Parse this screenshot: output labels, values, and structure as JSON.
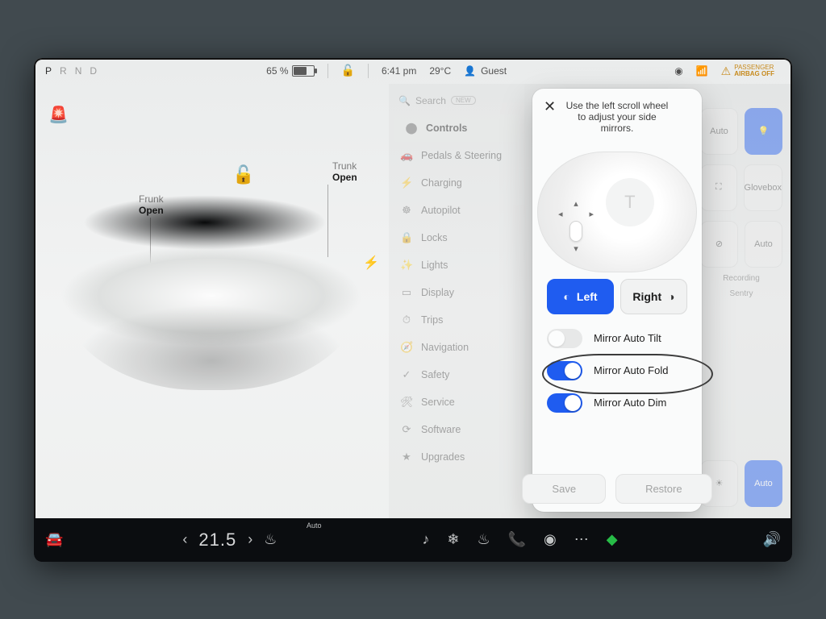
{
  "status": {
    "gear": {
      "p": "P",
      "r": "R",
      "n": "N",
      "d": "D",
      "active": "P"
    },
    "battery_pct": "65 %",
    "lock": "🔓",
    "time": "6:41 pm",
    "temp": "29°C",
    "user_label": "Guest",
    "airbag_line1": "PASSENGER",
    "airbag_line2": "AIRBAG OFF"
  },
  "carpane": {
    "frunk_label": "Frunk",
    "frunk_action": "Open",
    "trunk_label": "Trunk",
    "trunk_action": "Open"
  },
  "sidebar": {
    "search_placeholder": "Search",
    "new_pill": "NEW",
    "items": [
      {
        "icon": "⬤",
        "label": "Controls",
        "active": true
      },
      {
        "icon": "🚗",
        "label": "Pedals & Steering"
      },
      {
        "icon": "⚡",
        "label": "Charging"
      },
      {
        "icon": "☸",
        "label": "Autopilot"
      },
      {
        "icon": "🔒",
        "label": "Locks"
      },
      {
        "icon": "✨",
        "label": "Lights"
      },
      {
        "icon": "▭",
        "label": "Display"
      },
      {
        "icon": "⏱",
        "label": "Trips"
      },
      {
        "icon": "🧭",
        "label": "Navigation"
      },
      {
        "icon": "✓",
        "label": "Safety"
      },
      {
        "icon": "🛠",
        "label": "Service"
      },
      {
        "icon": "⟳",
        "label": "Software"
      },
      {
        "icon": "★",
        "label": "Upgrades"
      }
    ]
  },
  "rail": {
    "hl_auto": "Auto",
    "glovebox": "Glovebox",
    "wiper_auto": "Auto",
    "recording": "Recording",
    "sentry": "Sentry",
    "brightness_auto": "Auto"
  },
  "modal": {
    "hint": "Use the left scroll wheel to adjust your side mirrors.",
    "left": "Left",
    "right": "Right",
    "opts": [
      {
        "label": "Mirror Auto Tilt",
        "on": false,
        "disabled": true
      },
      {
        "label": "Mirror Auto Fold",
        "on": true,
        "highlight": true
      },
      {
        "label": "Mirror Auto Dim",
        "on": true
      }
    ],
    "save": "Save",
    "restore": "Restore"
  },
  "dock": {
    "temp": "21.5",
    "seat_auto": "Auto"
  }
}
